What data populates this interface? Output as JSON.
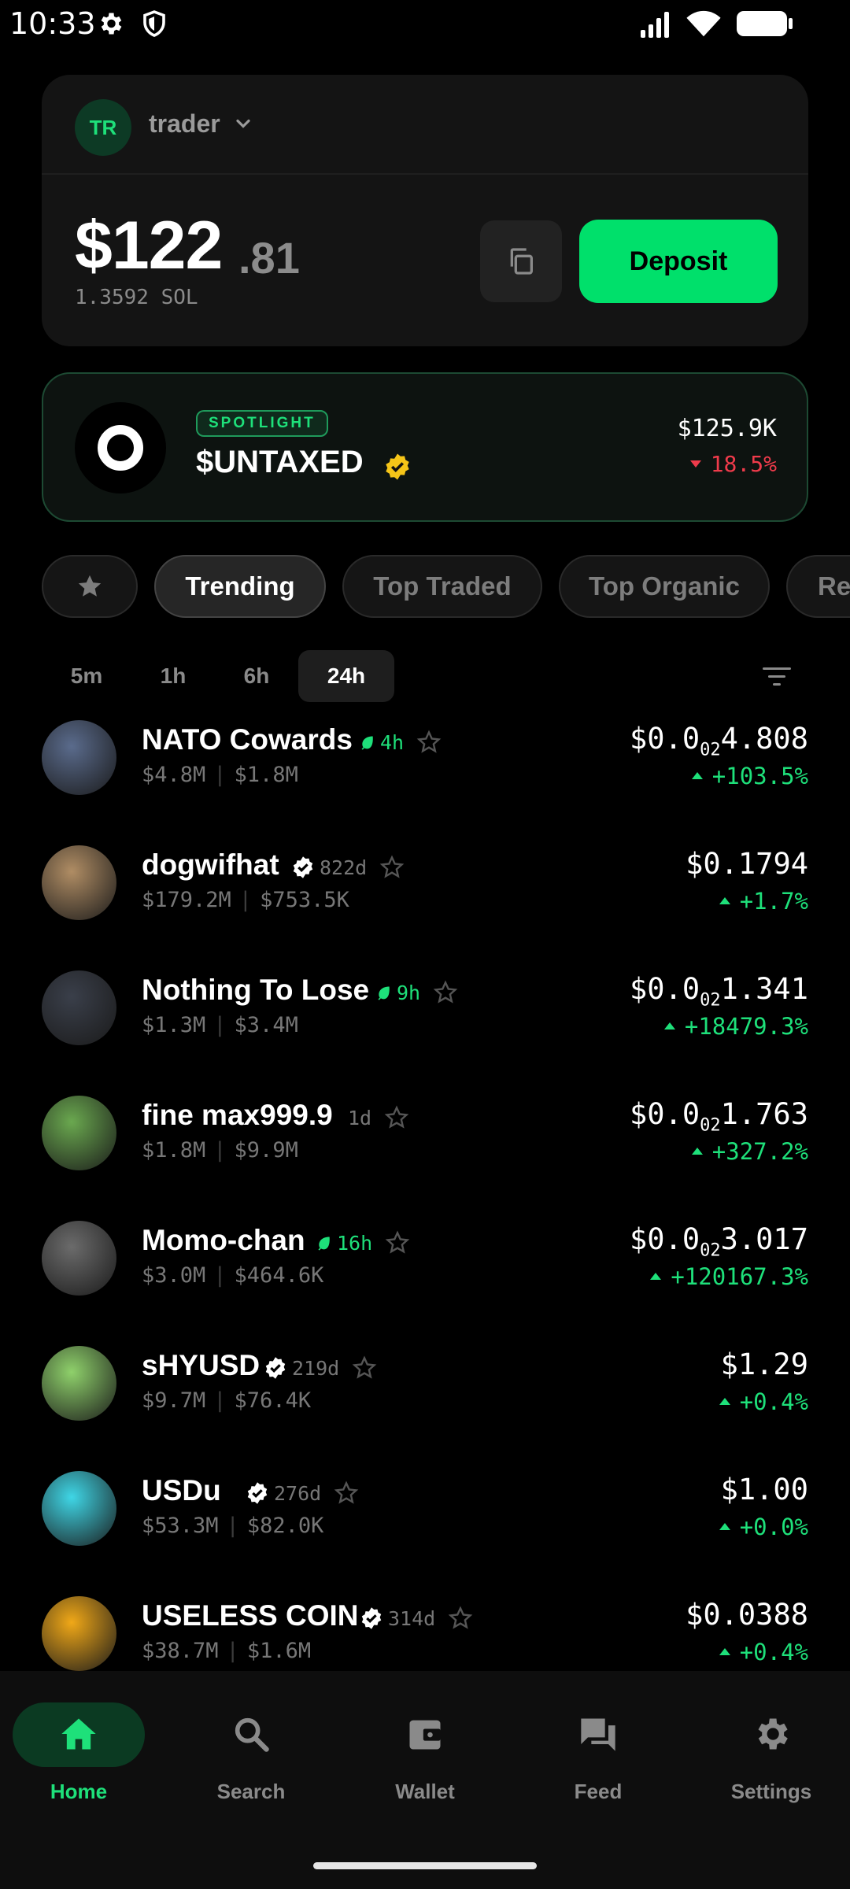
{
  "status_bar": {
    "time": "10:33"
  },
  "account": {
    "avatar_initials": "TR",
    "name": "trader",
    "balance_int": "$122",
    "balance_dec": ".81",
    "balance_sol": "1.3592 SOL",
    "deposit_label": "Deposit"
  },
  "spotlight": {
    "badge": "SPOTLIGHT",
    "name": "$UNTAXED",
    "market_cap": "$125.9K",
    "change": "18.5%"
  },
  "chips": [
    {
      "label": ""
    },
    {
      "label": "Trending"
    },
    {
      "label": "Top Traded"
    },
    {
      "label": "Top Organic"
    },
    {
      "label": "Re"
    }
  ],
  "time_tabs": [
    {
      "label": "5m"
    },
    {
      "label": "1h"
    },
    {
      "label": "6h"
    },
    {
      "label": "24h"
    }
  ],
  "tokens": [
    {
      "name": "NATO Cowards",
      "age": "4h",
      "age_type": "leaf",
      "mcap": "$4.8M",
      "vol": "$1.8M",
      "price_pre": "$0.0",
      "price_sub": "02",
      "price_post": "4.808",
      "change": "+103.5%",
      "avatar_color": "#5a6b8c"
    },
    {
      "name": "dogwifhat",
      "age": "822d",
      "age_type": "verified",
      "mcap": "$179.2M",
      "vol": "$753.5K",
      "price_pre": "$0.1794",
      "price_sub": "",
      "price_post": "",
      "change": "+1.7%",
      "avatar_color": "#b08d64"
    },
    {
      "name": "Nothing To Lose",
      "age": "9h",
      "age_type": "leaf",
      "mcap": "$1.3M",
      "vol": "$3.4M",
      "price_pre": "$0.0",
      "price_sub": "02",
      "price_post": "1.341",
      "change": "+18479.3%",
      "avatar_color": "#3a3f4a"
    },
    {
      "name": "fine max999.9",
      "age": "1d",
      "age_type": "none",
      "mcap": "$1.8M",
      "vol": "$9.9M",
      "price_pre": "$0.0",
      "price_sub": "02",
      "price_post": "1.763",
      "change": "+327.2%",
      "avatar_color": "#6aa84f"
    },
    {
      "name": "Momo-chan",
      "age": "16h",
      "age_type": "leaf",
      "mcap": "$3.0M",
      "vol": "$464.6K",
      "price_pre": "$0.0",
      "price_sub": "02",
      "price_post": "3.017",
      "change": "+120167.3%",
      "avatar_color": "#6b6b6b"
    },
    {
      "name": "sHYUSD",
      "age": "219d",
      "age_type": "verified",
      "mcap": "$9.7M",
      "vol": "$76.4K",
      "price_pre": "$1.29",
      "price_sub": "",
      "price_post": "",
      "change": "+0.4%",
      "avatar_color": "#8fd16b"
    },
    {
      "name": "USDu",
      "age": "276d",
      "age_type": "verified",
      "mcap": "$53.3M",
      "vol": "$82.0K",
      "price_pre": "$1.00",
      "price_sub": "",
      "price_post": "",
      "change": "+0.0%",
      "avatar_color": "#3fd6e6"
    },
    {
      "name": "USELESS COIN",
      "age": "314d",
      "age_type": "verified",
      "mcap": "$38.7M",
      "vol": "$1.6M",
      "price_pre": "$0.0388",
      "price_sub": "",
      "price_post": "",
      "change": "+0.4%",
      "avatar_color": "#f0a818"
    }
  ],
  "nav": [
    {
      "label": "Home",
      "icon": "home-icon"
    },
    {
      "label": "Search",
      "icon": "search-icon"
    },
    {
      "label": "Wallet",
      "icon": "wallet-icon"
    },
    {
      "label": "Feed",
      "icon": "feed-icon"
    },
    {
      "label": "Settings",
      "icon": "gear-icon"
    }
  ],
  "colors": {
    "accent": "#00e06b",
    "up": "#1ee07a",
    "down": "#ef3b4b"
  }
}
